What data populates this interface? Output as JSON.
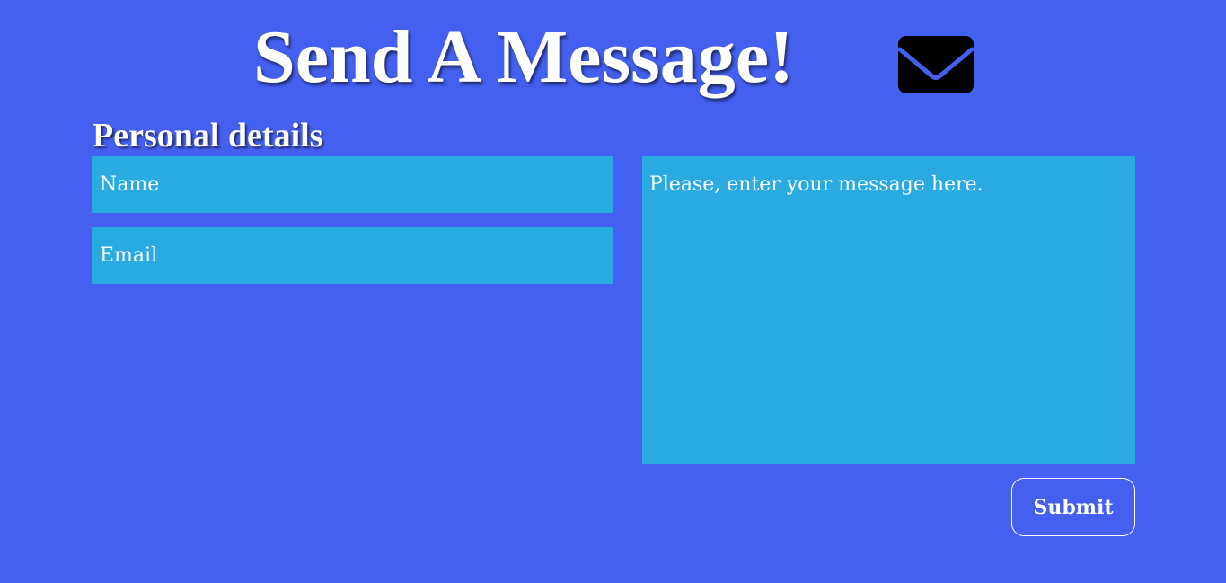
{
  "header": {
    "title": "Send A Message!",
    "icon": "envelope-icon"
  },
  "form": {
    "section_heading": "Personal details",
    "name": {
      "placeholder": "Name",
      "value": ""
    },
    "email": {
      "placeholder": "Email",
      "value": ""
    },
    "message": {
      "placeholder": "Please, enter your message here.",
      "value": ""
    },
    "submit_label": "Submit"
  },
  "colors": {
    "background": "#4460f1",
    "field_background": "#29abe2",
    "text": "#ffffff",
    "icon": "#000000"
  }
}
